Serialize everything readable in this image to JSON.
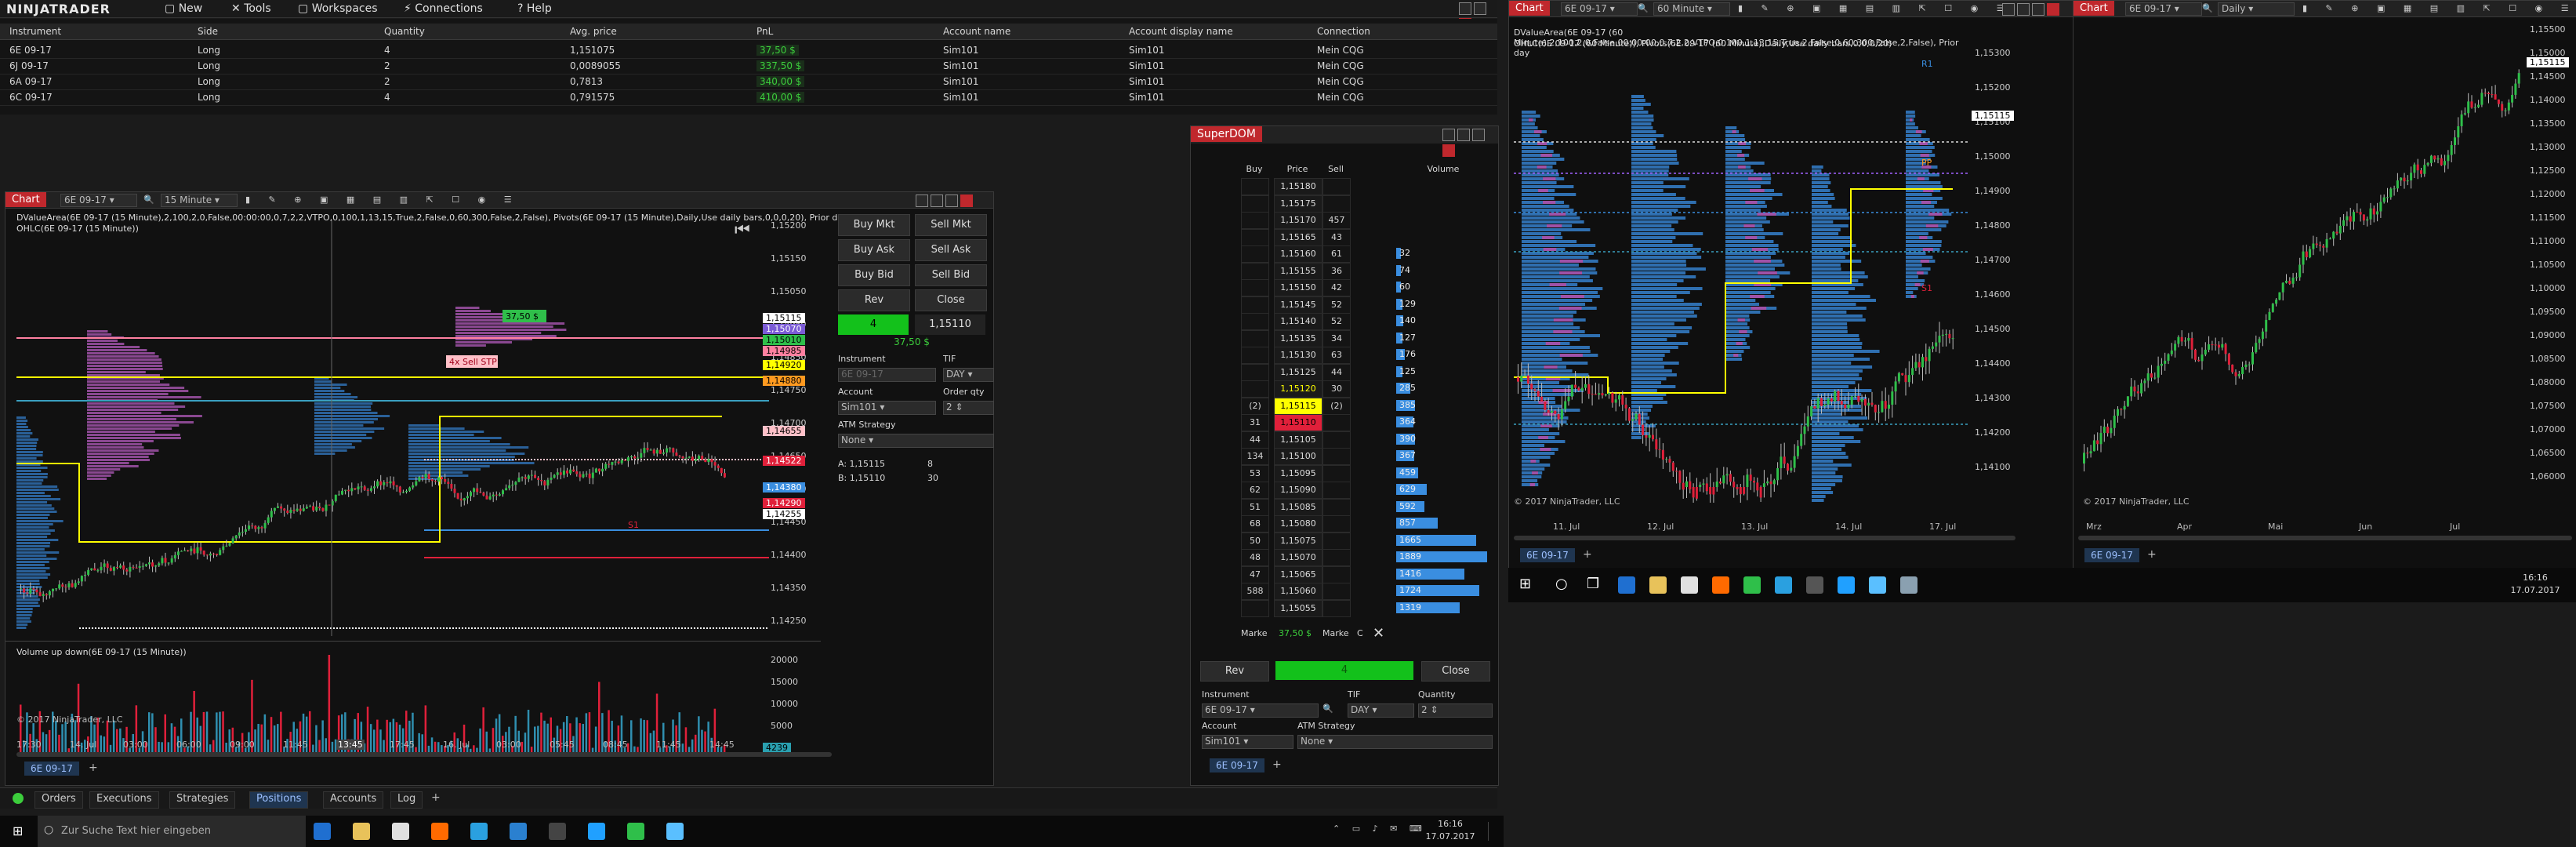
{
  "menu": {
    "logo": "NINJATRADER",
    "items": [
      "New",
      "Tools",
      "Workspaces",
      "Connections",
      "Help"
    ]
  },
  "positions": {
    "columns": [
      "Instrument",
      "Side",
      "Quantity",
      "Avg. price",
      "PnL",
      "Account name",
      "Account display name",
      "Connection"
    ],
    "rows": [
      [
        "6E 09-17",
        "Long",
        "4",
        "1,151075",
        "37,50 $",
        "Sim101",
        "Sim101",
        "Mein CQG"
      ],
      [
        "6J 09-17",
        "Long",
        "2",
        "0,0089055",
        "337,50 $",
        "Sim101",
        "Sim101",
        "Mein CQG"
      ],
      [
        "6A 09-17",
        "Long",
        "2",
        "0,7813",
        "340,00 $",
        "Sim101",
        "Sim101",
        "Mein CQG"
      ],
      [
        "6C 09-17",
        "Long",
        "4",
        "0,791575",
        "410,00 $",
        "Sim101",
        "Sim101",
        "Mein CQG"
      ]
    ]
  },
  "chart1": {
    "tag": "Chart",
    "instrument": "6E 09-17",
    "interval": "15 Minute",
    "indicator_line1": "DValueArea(6E 09-17 (15 Minute),2,100,2,0,False,00:00:00,0,7,2,2,VTPO,0,100,1,13,15,True,2,False,0,60,300,False,2,False), Pivots(6E 09-17 (15 Minute),Daily,Use daily bars,0,0,0,20), Prior day",
    "indicator_line2": "OHLC(6E 09-17 (15 Minute))",
    "price_labels": [
      "1,15200",
      "1,15150",
      "1,15050",
      "1,14950",
      "1,14850",
      "1,14750",
      "1,14700",
      "1,14650",
      "1,14550",
      "1,14450",
      "1,14400",
      "1,14350",
      "1,14250"
    ],
    "price_tags": [
      {
        "text": "1,15115",
        "color": "#ffffff",
        "fg": "#000"
      },
      {
        "text": "1,15070",
        "color": "#7b5bd6",
        "fg": "#fff"
      },
      {
        "text": "1,15010",
        "color": "#2fbf4a",
        "fg": "#000"
      },
      {
        "text": "1,14985",
        "color": "#ff80a0",
        "fg": "#000"
      },
      {
        "text": "1,14920",
        "color": "#ffff00",
        "fg": "#000"
      },
      {
        "text": "1,14880",
        "color": "#ff9a20",
        "fg": "#000"
      },
      {
        "text": "1,14655",
        "color": "#ffc0c8",
        "fg": "#000"
      },
      {
        "text": "1,14522",
        "color": "#e0203a",
        "fg": "#fff"
      },
      {
        "text": "1,14380",
        "color": "#3a8ee0",
        "fg": "#fff"
      },
      {
        "text": "1,14290",
        "color": "#e0203a",
        "fg": "#fff"
      },
      {
        "text": "1,14255",
        "color": "#ffffff",
        "fg": "#000"
      }
    ],
    "time_labels": [
      "17:30",
      "14. Jul",
      "03:00",
      "06:00",
      "09:00",
      "11:45",
      "13:45",
      "17:45",
      "16. Jul",
      "03:00",
      "05:45",
      "08:45",
      "11:45",
      "14:45"
    ],
    "volume_title": "Volume up down(6E 09-17 (15 Minute))",
    "volume_labels": [
      "20000",
      "15000",
      "10000",
      "5000"
    ],
    "volume_last": "4239",
    "copyright": "© 2017 NinjaTrader, LLC",
    "tab": "6E 09-17",
    "order_tag": "37,50 $",
    "sell_stp": "4x  Sell STP",
    "s1_label": "S1"
  },
  "chart_trader": {
    "buy_mkt": "Buy Mkt",
    "sell_mkt": "Sell Mkt",
    "buy_ask": "Buy Ask",
    "sell_ask": "Sell Ask",
    "buy_bid": "Buy Bid",
    "sell_bid": "Sell Bid",
    "rev": "Rev",
    "close": "Close",
    "position_qty": "4",
    "position_price": "1,15110",
    "pnl": "37,50 $",
    "instrument_label": "Instrument",
    "instrument_value": "6E 09-17",
    "tif_label": "TIF",
    "tif_value": "DAY",
    "account_label": "Account",
    "account_value": "Sim101",
    "order_qty_label": "Order qty",
    "order_qty_value": "2",
    "atm_label": "ATM Strategy",
    "atm_value": "None",
    "ask_label": "A:",
    "ask_price": "1,15115",
    "ask_size": "8",
    "bid_label": "B:",
    "bid_price": "1,15110",
    "bid_size": "30"
  },
  "superdom": {
    "title": "SuperDOM",
    "headers": [
      "Buy",
      "Price",
      "Sell",
      "Volume"
    ],
    "rows": [
      {
        "buy": "",
        "price": "1,15180",
        "sell": "",
        "vol": "",
        "v": 0
      },
      {
        "buy": "",
        "price": "1,15175",
        "sell": "",
        "vol": "",
        "v": 0
      },
      {
        "buy": "",
        "price": "1,15170",
        "sell": "457",
        "vol": "",
        "v": 0
      },
      {
        "buy": "",
        "price": "1,15165",
        "sell": "43",
        "vol": "",
        "v": 0
      },
      {
        "buy": "",
        "price": "1,15160",
        "sell": "61",
        "vol": "32",
        "v": 32
      },
      {
        "buy": "",
        "price": "1,15155",
        "sell": "36",
        "vol": "74",
        "v": 74
      },
      {
        "buy": "",
        "price": "1,15150",
        "sell": "42",
        "vol": "60",
        "v": 60
      },
      {
        "buy": "",
        "price": "1,15145",
        "sell": "52",
        "vol": "129",
        "v": 129
      },
      {
        "buy": "",
        "price": "1,15140",
        "sell": "52",
        "vol": "140",
        "v": 140
      },
      {
        "buy": "",
        "price": "1,15135",
        "sell": "34",
        "vol": "127",
        "v": 127
      },
      {
        "buy": "",
        "price": "1,15130",
        "sell": "63",
        "vol": "176",
        "v": 176
      },
      {
        "buy": "",
        "price": "1,15125",
        "sell": "44",
        "vol": "125",
        "v": 125
      },
      {
        "buy": "",
        "price": "1,15120",
        "sell": "30",
        "vol": "285",
        "v": 285
      },
      {
        "buy": "(2)",
        "price": "1,15115",
        "sell": "(2)",
        "vol": "385",
        "v": 385
      },
      {
        "buy": "31",
        "price": "1,15110",
        "sell": "",
        "vol": "364",
        "v": 364
      },
      {
        "buy": "44",
        "price": "1,15105",
        "sell": "",
        "vol": "390",
        "v": 390
      },
      {
        "buy": "134",
        "price": "1,15100",
        "sell": "",
        "vol": "367",
        "v": 367
      },
      {
        "buy": "53",
        "price": "1,15095",
        "sell": "",
        "vol": "459",
        "v": 459
      },
      {
        "buy": "62",
        "price": "1,15090",
        "sell": "",
        "vol": "629",
        "v": 629
      },
      {
        "buy": "51",
        "price": "1,15085",
        "sell": "",
        "vol": "592",
        "v": 592
      },
      {
        "buy": "68",
        "price": "1,15080",
        "sell": "",
        "vol": "857",
        "v": 857
      },
      {
        "buy": "50",
        "price": "1,15075",
        "sell": "",
        "vol": "1665",
        "v": 1665
      },
      {
        "buy": "48",
        "price": "1,15070",
        "sell": "",
        "vol": "1889",
        "v": 1889
      },
      {
        "buy": "47",
        "price": "1,15065",
        "sell": "",
        "vol": "1416",
        "v": 1416
      },
      {
        "buy": "588",
        "price": "1,15060",
        "sell": "",
        "vol": "1724",
        "v": 1724
      },
      {
        "buy": "",
        "price": "1,15055",
        "sell": "",
        "vol": "1319",
        "v": 1319
      }
    ],
    "market_left": "Marke",
    "pnl": "37,50 $",
    "market_right": "Marke",
    "c_label": "C",
    "rev": "Rev",
    "position_qty": "4",
    "close": "Close",
    "instrument_label": "Instrument",
    "tif_label": "TIF",
    "quantity_label": "Quantity",
    "instrument_value": "6E 09-17",
    "tif_value": "DAY",
    "quantity_value": "2",
    "account_label": "Account",
    "atm_label": "ATM Strategy",
    "account_value": "Sim101",
    "atm_value": "None",
    "tab": "6E 09-17"
  },
  "chart2": {
    "tag": "Chart",
    "instrument": "6E 09-17",
    "interval": "60 Minute",
    "indicator_line1": "DValueArea(6E 09-17 (60 Minute),2,100,2,0,False,00:00:00,0,7,2,2,VTPO,0,100,1,13,15,True,2,False,0,60,300,False,2,False), Prior day",
    "indicator_line2": "OHLC(6E 09-17 (60 Minute)), Pivots(6E 09-17 (60 Minute),Daily,Use daily bars,0,0,0,20)",
    "price_labels": [
      "1,15300",
      "1,15200",
      "1,15100",
      "1,15000",
      "1,14900",
      "1,14800",
      "1,14700",
      "1,14600",
      "1,14500",
      "1,14400",
      "1,14300",
      "1,14200",
      "1,14100"
    ],
    "current_price": "1,15115",
    "time_labels": [
      "11. Jul",
      "12. Jul",
      "13. Jul",
      "14. Jul",
      "17. Jul"
    ],
    "copyright": "© 2017 NinjaTrader, LLC",
    "tab": "6E 09-17",
    "r1": "R1",
    "pp": "PP",
    "s1": "S1"
  },
  "chart3": {
    "tag": "Chart",
    "instrument": "6E 09-17",
    "interval": "Daily",
    "price_labels": [
      "1,15500",
      "1,15000",
      "1,14500",
      "1,14000",
      "1,13500",
      "1,13000",
      "1,12500",
      "1,12000",
      "1,11500",
      "1,11000",
      "1,10500",
      "1,10000",
      "1,09500",
      "1,09000",
      "1,08500",
      "1,08000",
      "1,07500",
      "1,07000",
      "1,06500",
      "1,06000"
    ],
    "current_price": "1,15115",
    "time_labels": [
      "Mrz",
      "Apr",
      "Mai",
      "Jun",
      "Jul"
    ],
    "copyright": "© 2017 NinjaTrader, LLC",
    "tab": "6E 09-17"
  },
  "bottom_tabs": [
    "Orders",
    "Executions",
    "Strategies",
    "Positions",
    "Accounts",
    "Log"
  ],
  "active_tab": "Positions",
  "taskbar_left": {
    "search_placeholder": "Zur Suche Text hier eingeben",
    "time": "16:16",
    "date": "17.07.2017"
  },
  "taskbar_right": {
    "time": "16:16",
    "date": "17.07.2017"
  },
  "colors": {
    "accent_red": "#c0282d",
    "buy_green": "#13c11b",
    "profit_green": "#3ccd3c",
    "ask_yellow": "#ffff00",
    "value_area_purple": "#c060c0",
    "profile_blue": "#2f6fb0"
  }
}
